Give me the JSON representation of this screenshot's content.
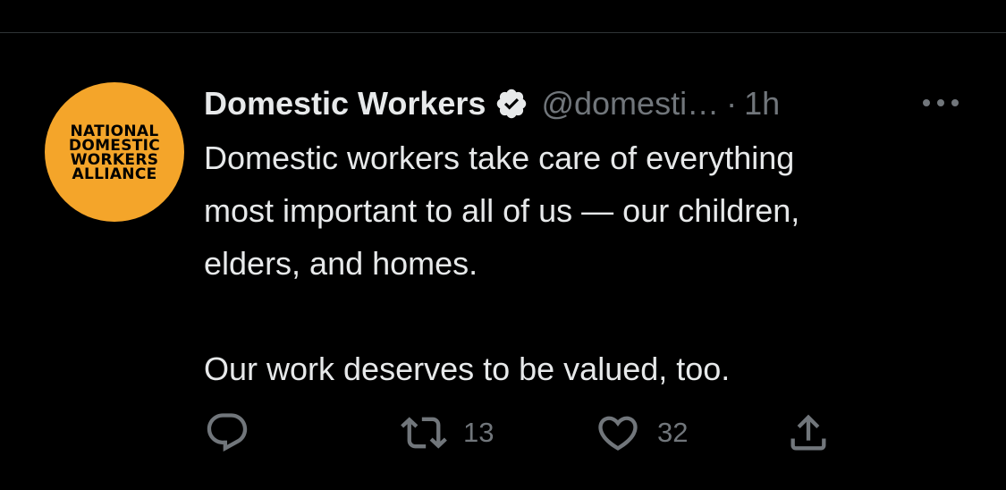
{
  "avatar": {
    "lines": [
      "NATIONAL",
      "DOMESTIC",
      "WORKERS",
      "ALLIANCE"
    ],
    "color": "#f4a52a"
  },
  "tweet": {
    "author_name": "Domestic Workers",
    "handle": "@domesti…",
    "separator": "·",
    "time": "1h",
    "verified": true,
    "text": "Domestic workers take care of everything\nmost important to all of us — our children,\nelders, and homes.\n\nOur work deserves to be valued, too."
  },
  "actions": {
    "reply": {
      "icon": "reply-icon"
    },
    "retweet": {
      "icon": "retweet-icon",
      "count": "13"
    },
    "like": {
      "icon": "heart-icon",
      "count": "32"
    },
    "share": {
      "icon": "share-icon"
    }
  },
  "colors": {
    "background": "#000000",
    "text_primary": "#e7e9ea",
    "text_secondary": "#71767b"
  }
}
